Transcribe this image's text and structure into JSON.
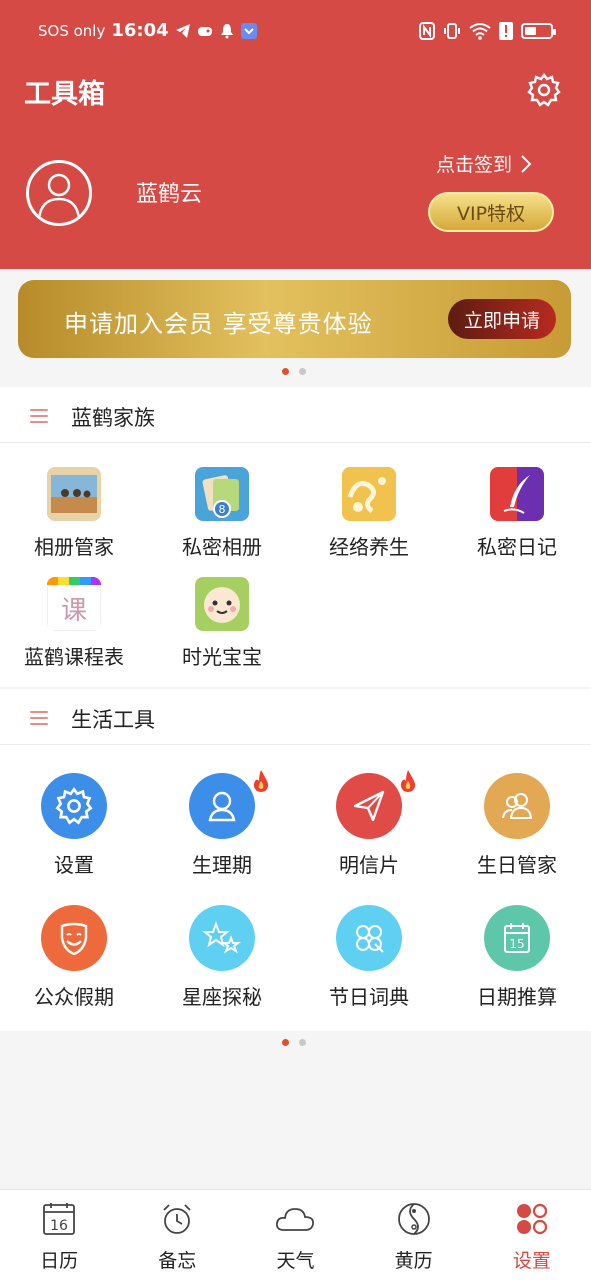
{
  "status_bar": {
    "carrier": "SOS only",
    "time": "16:04"
  },
  "header": {
    "title": "工具箱",
    "username": "蓝鹤云",
    "checkin_label": "点击签到",
    "vip_label": "VIP特权"
  },
  "banner": {
    "text": "申请加入会员  享受尊贵体验",
    "button_label": "立即申请"
  },
  "family": {
    "title": "蓝鹤家族",
    "items": [
      {
        "label": "相册管家",
        "icon": "photo-album-icon"
      },
      {
        "label": "私密相册",
        "icon": "private-album-icon"
      },
      {
        "label": "经络养生",
        "icon": "meridian-icon"
      },
      {
        "label": "私密日记",
        "icon": "diary-icon"
      },
      {
        "label": "蓝鹤课程表",
        "icon": "schedule-icon"
      },
      {
        "label": "时光宝宝",
        "icon": "baby-icon"
      }
    ]
  },
  "tools": {
    "title": "生活工具",
    "items": [
      {
        "label": "设置",
        "icon": "gear-icon",
        "color": "#3d8ee8"
      },
      {
        "label": "生理期",
        "icon": "woman-icon",
        "color": "#3d8ee8",
        "hot": true
      },
      {
        "label": "明信片",
        "icon": "paper-plane-icon",
        "color": "#e04a47",
        "hot": true
      },
      {
        "label": "生日管家",
        "icon": "people-icon",
        "color": "#e3a853"
      },
      {
        "label": "公众假期",
        "icon": "smile-shield-icon",
        "color": "#ee6a3c"
      },
      {
        "label": "星座探秘",
        "icon": "stars-icon",
        "color": "#5fd0f2"
      },
      {
        "label": "节日词典",
        "icon": "clover-icon",
        "color": "#5fd0f2"
      },
      {
        "label": "日期推算",
        "icon": "calendar-icon",
        "color": "#5fc7a9"
      }
    ]
  },
  "bottom_nav": {
    "items": [
      {
        "label": "日历",
        "icon": "calendar-icon",
        "day": "16"
      },
      {
        "label": "备忘",
        "icon": "alarm-clock-icon"
      },
      {
        "label": "天气",
        "icon": "cloud-icon"
      },
      {
        "label": "黄历",
        "icon": "yin-yang-icon"
      },
      {
        "label": "设置",
        "icon": "four-dots-icon",
        "active": true
      }
    ]
  },
  "colors": {
    "header_bg": "#d54a45",
    "accent": "#d54a45",
    "gold": "#d4a93a"
  }
}
